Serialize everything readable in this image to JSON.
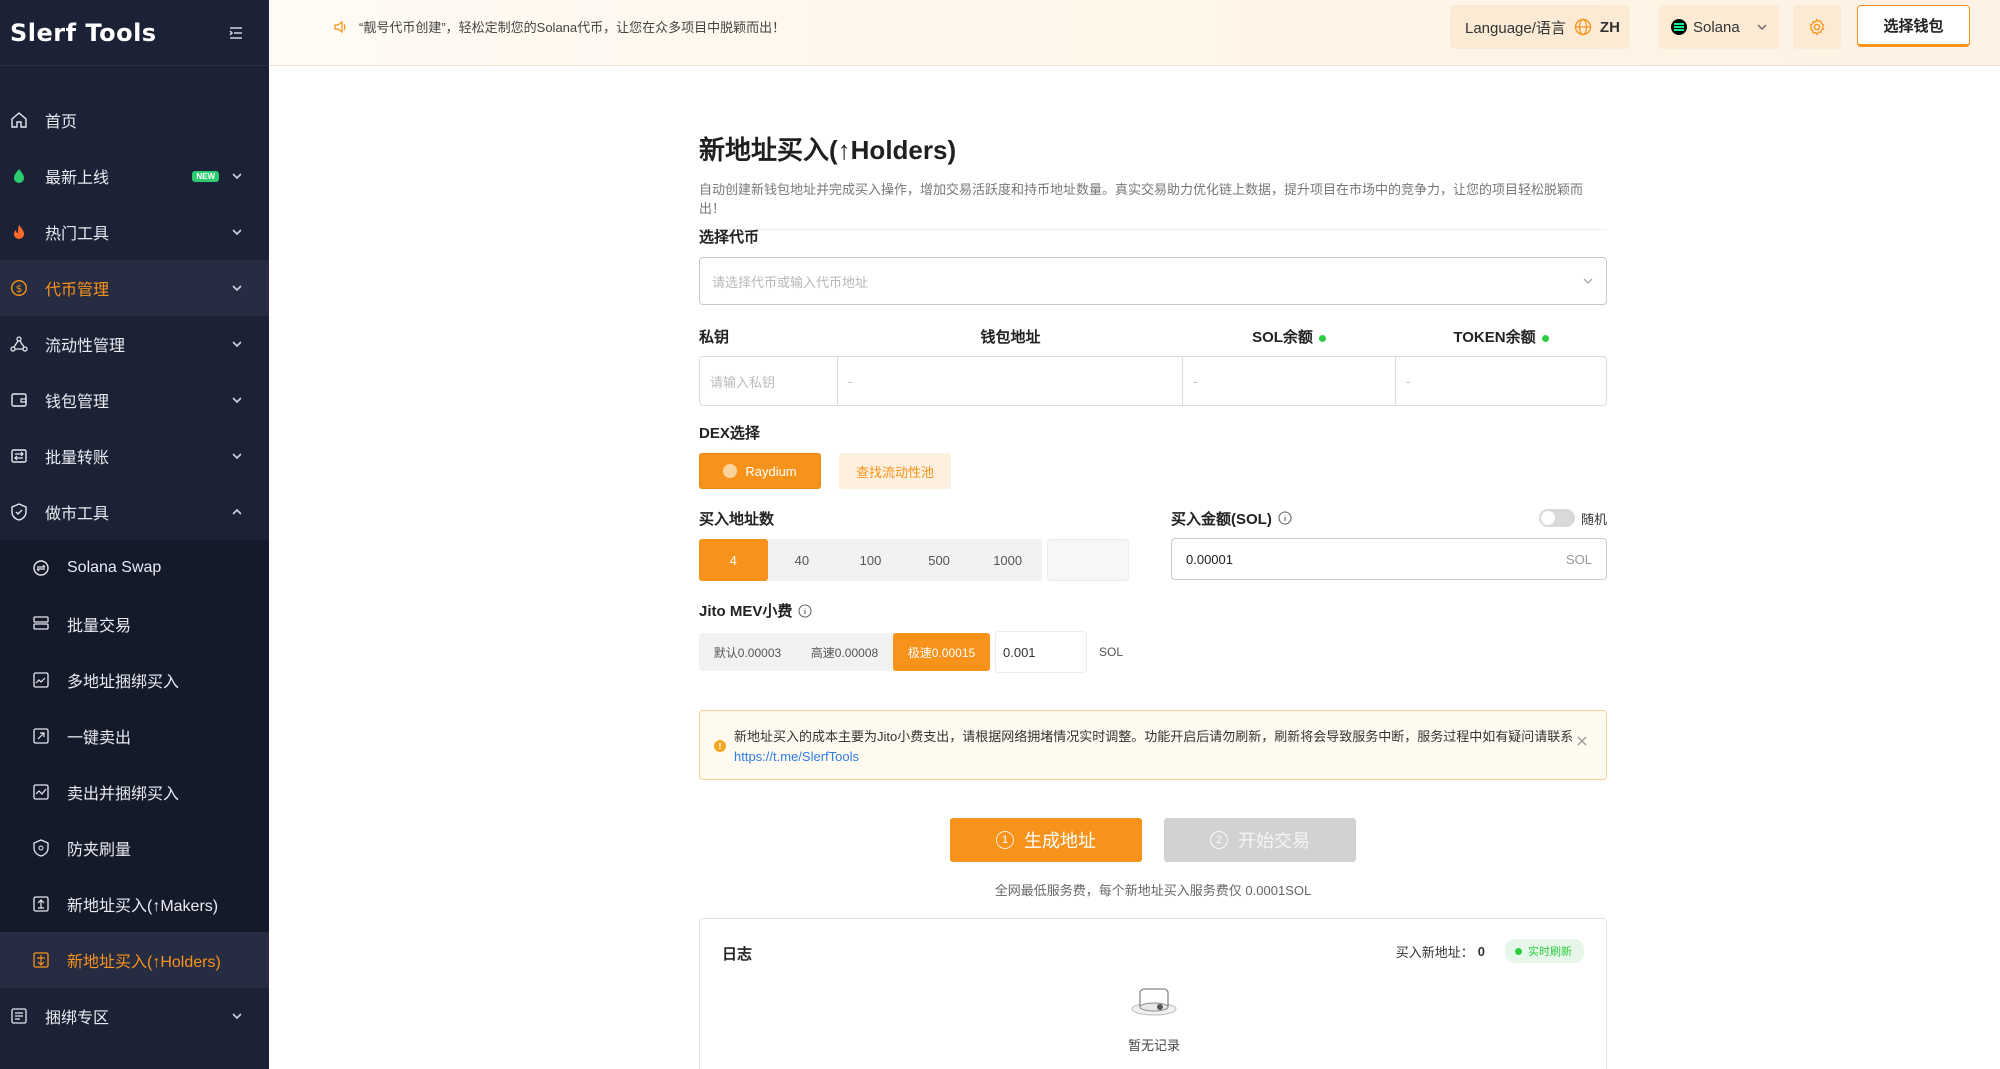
{
  "brand": {
    "logo": "Slerf Tools",
    "accent": "#f7931a",
    "sidebar_bg": "#1c2235"
  },
  "topbar": {
    "notice": "“靓号代币创建”，轻松定制您的Solana代币，让您在众多项目中脱颖而出！",
    "language_label": "Language/语言",
    "language_code": "ZH",
    "chain": "Solana",
    "wallet_button": "选择钱包"
  },
  "sidebar": {
    "items": [
      {
        "label": "首页",
        "icon": "home-icon"
      },
      {
        "label": "最新上线",
        "icon": "new-icon",
        "badge": "NEW"
      },
      {
        "label": "热门工具",
        "icon": "fire-icon"
      },
      {
        "label": "代币管理",
        "icon": "coin-icon"
      },
      {
        "label": "流动性管理",
        "icon": "liquidity-icon"
      },
      {
        "label": "钱包管理",
        "icon": "wallet-icon"
      },
      {
        "label": "批量转账",
        "icon": "transfer-icon"
      },
      {
        "label": "做市工具",
        "icon": "shield-icon"
      }
    ],
    "sub_items": [
      {
        "label": "Solana Swap",
        "icon": "swap-icon"
      },
      {
        "label": "批量交易",
        "icon": "batch-icon"
      },
      {
        "label": "多地址捆绑买入",
        "icon": "bundle-buy-icon"
      },
      {
        "label": "一键卖出",
        "icon": "sell-icon"
      },
      {
        "label": "卖出并捆绑买入",
        "icon": "chart-icon"
      },
      {
        "label": "防夹刷量",
        "icon": "protect-icon"
      },
      {
        "label": "新地址买入(↑Makers)",
        "icon": "makers-icon"
      },
      {
        "label": "新地址买入(↑Holders)",
        "icon": "holders-icon"
      }
    ],
    "after": [
      {
        "label": "捆绑专区",
        "icon": "bundle-zone-icon"
      }
    ]
  },
  "main": {
    "title": "新地址买入(↑Holders)",
    "description": "自动创建新钱包地址并完成买入操作，增加交易活跃度和持币地址数量。真实交易助力优化链上数据，提升项目在市场中的竞争力，让您的项目轻松脱颖而出！",
    "select_token_label": "选择代币",
    "select_token_placeholder": "请选择代币或输入代币地址",
    "wallet_table": {
      "col_private_key": "私钥",
      "col_address": "钱包地址",
      "col_sol": "SOL余额",
      "col_token": "TOKEN余额",
      "private_key_placeholder": "请输入私钥",
      "address_value": "-",
      "sol_value": "-",
      "token_value": "-"
    },
    "dex_label": "DEX选择",
    "dex_selected": "Raydium",
    "find_pool": "查找流动性池",
    "address_count_label": "买入地址数",
    "address_counts": [
      "4",
      "40",
      "100",
      "500",
      "1000"
    ],
    "buy_amount_label": "买入金额(SOL)",
    "random_label": "随机",
    "buy_amount_value": "0.00001",
    "buy_amount_unit": "SOL",
    "jito_label": "Jito MEV小费",
    "jito_options": [
      "默认0.00003",
      "高速0.00008",
      "极速0.00015"
    ],
    "jito_value": "0.001",
    "jito_unit": "SOL",
    "warning_text": "新地址买入的成本主要为Jito小费支出，请根据网络拥堵情况实时调整。功能开启后请勿刷新，刷新将会导致服务中断，服务过程中如有疑问请联系",
    "warning_link": "https://t.me/SlerfTools",
    "btn_generate_num": "1",
    "btn_generate": "生成地址",
    "btn_start_num": "2",
    "btn_start": "开始交易",
    "fee_note": "全网最低服务费，每个新地址买入服务费仅 0.0001SOL",
    "log_title": "日志",
    "log_count_label": "买入新地址：",
    "log_count": "0",
    "live_label": "实时刷新",
    "empty_text": "暂无记录"
  }
}
